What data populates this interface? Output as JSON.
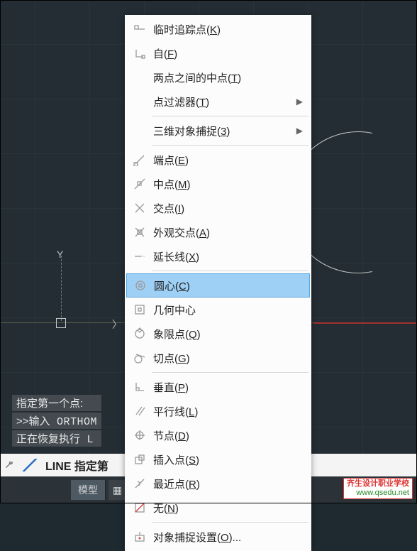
{
  "menu": {
    "items": [
      {
        "label": "临时追踪点",
        "accel": "K",
        "icon": "track-point-icon"
      },
      {
        "label": "自",
        "accel": "F",
        "icon": "from-icon"
      },
      {
        "label": "两点之间的中点",
        "accel": "T",
        "icon": "",
        "indent": true
      },
      {
        "label": "点过滤器",
        "accel": "T",
        "icon": "",
        "submenu": true,
        "indent": true
      },
      {
        "sep": true
      },
      {
        "label": "三维对象捕捉",
        "accel": "3",
        "icon": "",
        "submenu": true,
        "indent": true
      },
      {
        "sep": true
      },
      {
        "label": "端点",
        "accel": "E",
        "icon": "endpoint-icon"
      },
      {
        "label": "中点",
        "accel": "M",
        "icon": "midpoint-icon"
      },
      {
        "label": "交点",
        "accel": "I",
        "icon": "intersection-icon"
      },
      {
        "label": "外观交点",
        "accel": "A",
        "icon": "apparent-intersect-icon"
      },
      {
        "label": "延长线",
        "accel": "X",
        "icon": "extension-icon"
      },
      {
        "sep": true
      },
      {
        "label": "圆心",
        "accel": "C",
        "icon": "center-icon",
        "highlight": true
      },
      {
        "label": "几何中心",
        "accel": "",
        "icon": "geo-center-icon"
      },
      {
        "label": "象限点",
        "accel": "Q",
        "icon": "quadrant-icon"
      },
      {
        "label": "切点",
        "accel": "G",
        "icon": "tangent-icon"
      },
      {
        "sep": true
      },
      {
        "label": "垂直",
        "accel": "P",
        "icon": "perpendicular-icon"
      },
      {
        "label": "平行线",
        "accel": "L",
        "icon": "parallel-icon"
      },
      {
        "label": "节点",
        "accel": "D",
        "icon": "node-icon"
      },
      {
        "label": "插入点",
        "accel": "S",
        "icon": "insert-icon"
      },
      {
        "label": "最近点",
        "accel": "R",
        "icon": "nearest-icon"
      },
      {
        "label": "无",
        "accel": "N",
        "icon": "none-icon"
      },
      {
        "sep": true
      },
      {
        "label": "对象捕捉设置",
        "accel": "O",
        "post": "...",
        "icon": "osnap-settings-icon"
      }
    ]
  },
  "history": {
    "l1": "指定第一个点:",
    "l2a": ">>输入",
    "l2b": " ORTHOM",
    "l3a": "正在恢复执行",
    "l3b": " L"
  },
  "cmdline": {
    "cmd": "LINE",
    "prompt": " 指定第"
  },
  "status": {
    "model": "模型",
    "grid_glyph": "▦",
    "snap_glyph": "⫴"
  },
  "axes": {
    "y": "Y",
    "x_arrow": "〉"
  },
  "watermark": {
    "l1": "齐生设计职业学校",
    "l2": "www.qsedu.net"
  }
}
